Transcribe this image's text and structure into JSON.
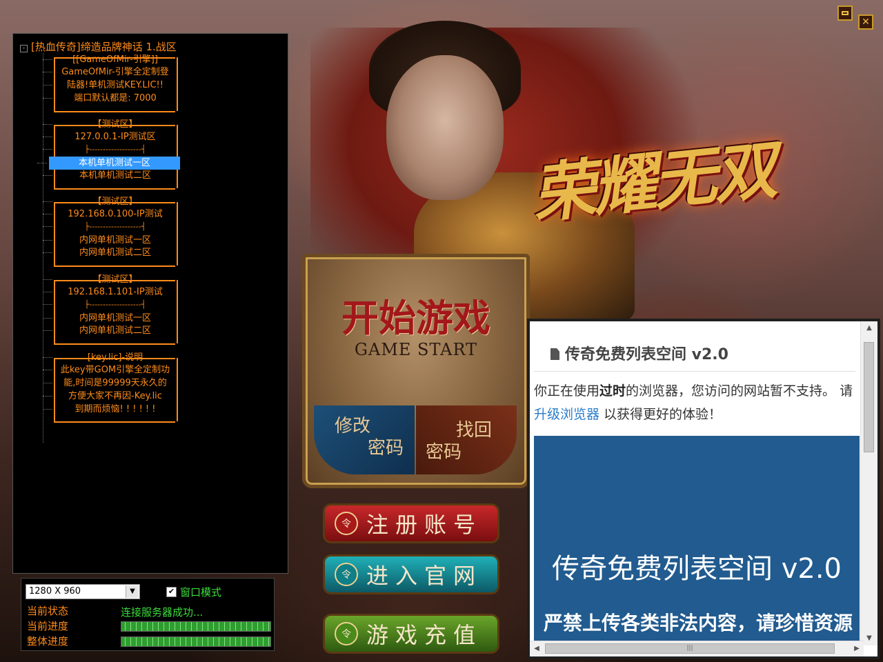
{
  "window": {
    "minimize_icon": "minimize-icon",
    "close_icon": "close-icon",
    "close_glyph": "✕"
  },
  "tree": {
    "root_label": "[热血传奇]缔造品牌神话 1.战区",
    "expander": "⊟",
    "groups": [
      {
        "lines": [
          "[[GameOfMir-引擎]]",
          "GameOfMir-引擎全定制登",
          "陆器!单机测试KEY.LIC!!",
          "端口默认都是: 7000"
        ]
      },
      {
        "lines": [
          "【测试区】",
          "127.0.0.1-IP测试区",
          "本机单机测试一区",
          "本机单机测试二区"
        ]
      },
      {
        "lines": [
          "【测试区】",
          "192.168.0.100-IP测试",
          "内网单机测试一区",
          "内网单机测试二区"
        ]
      },
      {
        "lines": [
          "【测试区】",
          "192.168.1.101-IP测试",
          "内网单机测试一区",
          "内网单机测试二区"
        ]
      },
      {
        "lines": [
          "[key.lic]-说明",
          "此key带GOM引擎全定制功",
          "能,时间是99999天永久的",
          "方便大家不再因-Key.lic",
          "到期而烦恼! ! ! ! ! !"
        ]
      }
    ],
    "selected": "本机单机测试一区"
  },
  "status": {
    "resolution": "1280 X 960",
    "window_mode_label": "窗口模式",
    "window_mode_checked": true,
    "current_state_label": "当前状态",
    "current_state_value": "连接服务器成功...",
    "current_progress_label": "当前进度",
    "overall_progress_label": "整体进度",
    "current_progress": 100,
    "overall_progress": 100
  },
  "menu": {
    "start_cn": "开始游戏",
    "start_en": "GAME START",
    "change_pw_1": "修改",
    "change_pw_2": "密码",
    "find_pw_1": "找回",
    "find_pw_2": "密码",
    "register": "注册账号",
    "official": "进入官网",
    "recharge": "游戏充值",
    "emblem": "令"
  },
  "logo": {
    "text": "荣耀无双"
  },
  "browser": {
    "title": "传奇免费列表空间 v2.0",
    "warn_1": "你正在使用",
    "warn_bold": "过时",
    "warn_2": "的浏览器，您访问的网站暂不支持。 请",
    "upgrade_link": "升级浏览器",
    "warn_3": " 以获得更好的体验！",
    "banner_title": "传奇免费列表空间 v2.0",
    "banner_note": "严禁上传各类非法内容，请珍惜资源"
  }
}
